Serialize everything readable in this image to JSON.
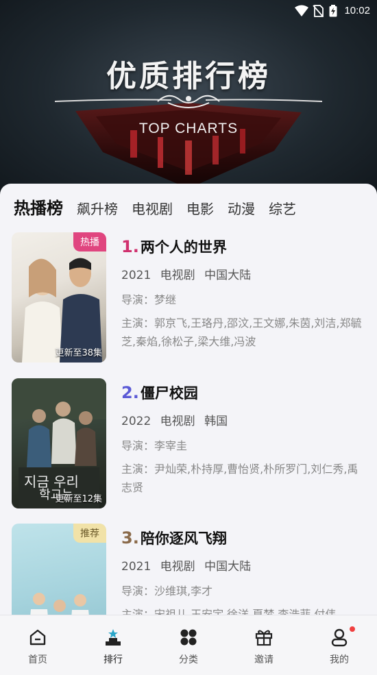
{
  "status_bar": {
    "time": "10:02"
  },
  "hero": {
    "title": "优质排行榜",
    "subtitle": "TOP CHARTS"
  },
  "tabs": [
    "热播榜",
    "飙升榜",
    "电视剧",
    "电影",
    "动漫",
    "综艺"
  ],
  "items": [
    {
      "rank": "1.",
      "rank_color": "#d0306e",
      "title": "两个人的世界",
      "year": "2021",
      "type": "电视剧",
      "region": "中国大陆",
      "director": "导演：梦继",
      "cast": "主演：郭京飞,王珞丹,邵汶,王文娜,朱茵,刘洁,郑毓芝,秦焰,徐松子,梁大维,冯波",
      "badge": "热播",
      "badge_color": "#e0457f",
      "update": "更新至38集"
    },
    {
      "rank": "2.",
      "rank_color": "#5b5ad6",
      "title": "僵尸校园",
      "year": "2022",
      "type": "电视剧",
      "region": "韩国",
      "director": "导演：李宰圭",
      "cast": "主演：尹灿荣,朴持厚,曹怡贤,朴所罗门,刘仁秀,禹志贤",
      "badge": "",
      "update": "更新至12集"
    },
    {
      "rank": "3.",
      "rank_color": "#8a6a4a",
      "title": "陪你逐风飞翔",
      "year": "2021",
      "type": "电视剧",
      "region": "中国大陆",
      "director": "导演：沙维琪,李才",
      "cast": "主演：宋祖儿,王安宇,徐洋,夏梦,李浩菲,付伟",
      "badge": "推荐",
      "badge_color": "#f1e2a8",
      "update": ""
    }
  ],
  "nav": [
    {
      "label": "首页",
      "icon": "home-icon"
    },
    {
      "label": "排行",
      "icon": "ranking-icon"
    },
    {
      "label": "分类",
      "icon": "category-icon"
    },
    {
      "label": "邀请",
      "icon": "gift-icon"
    },
    {
      "label": "我的",
      "icon": "profile-icon"
    }
  ]
}
